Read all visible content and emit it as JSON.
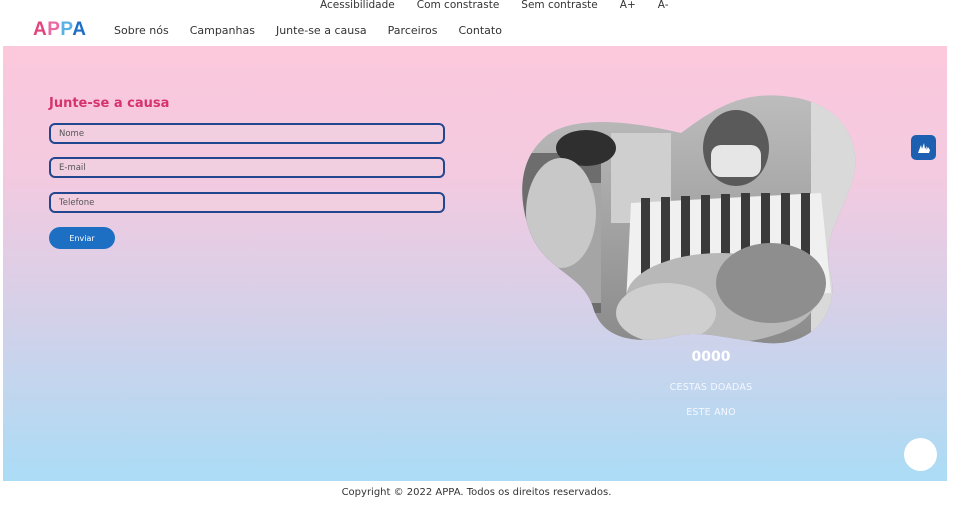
{
  "accessibility": {
    "items": [
      "Acessibilidade",
      "Com constraste",
      "Sem contraste",
      "A+",
      "A-"
    ]
  },
  "logo": {
    "letters": [
      "A",
      "P",
      "P",
      "A"
    ]
  },
  "nav": {
    "items": [
      "Sobre nós",
      "Campanhas",
      "Junte-se a causa",
      "Parceiros",
      "Contato"
    ]
  },
  "form": {
    "title": "Junte-se a causa",
    "name_placeholder": "Nome",
    "email_placeholder": "E-mail",
    "phone_placeholder": "Telefone",
    "submit_label": "Enviar"
  },
  "stats": {
    "number": "0000",
    "line1": "CESTAS DOADAS",
    "line2": "ESTE ANO"
  },
  "icons": {
    "vlibras": "sign-language-hands-icon",
    "chat": "chat-bubble-icon"
  },
  "colors": {
    "brand_pink": "#d6336c",
    "brand_blue": "#1d6fc4",
    "field_border": "#23478f"
  },
  "footer": {
    "copyright": "Copyright © 2022 APPA. Todos os direitos reservados."
  }
}
